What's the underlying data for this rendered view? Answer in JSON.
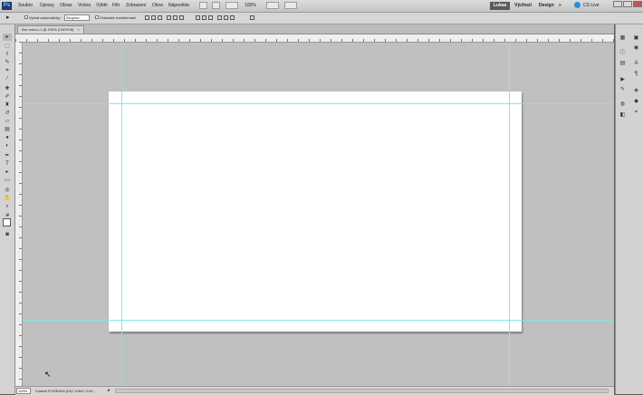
{
  "menubar": {
    "logo": "Ps",
    "items": [
      "Soubor",
      "Úpravy",
      "Obraz",
      "Vrstva",
      "Výběr",
      "Filtr",
      "Zobrazení",
      "Okna",
      "Nápověda"
    ],
    "zoom": "100%",
    "workspaces": [
      "Lukas",
      "Výchozí",
      "Design"
    ],
    "more": "»",
    "cs_live": "CS Live"
  },
  "options": {
    "auto_select_label": "Vybrat automaticky:",
    "auto_select_value": "Skupina",
    "transform_label": "Ovladače transformací"
  },
  "document": {
    "tab_title": "Bez názvu-1 @ 100% (CMYK/8)"
  },
  "status": {
    "zoom": "100%",
    "info": "Coated FOGRA39 (ISO 12647-2:20..."
  },
  "colors": {
    "guide": "#7fe6ea",
    "pasteboard": "#c0c0c0",
    "active_workspace": "#5a5a5a"
  }
}
